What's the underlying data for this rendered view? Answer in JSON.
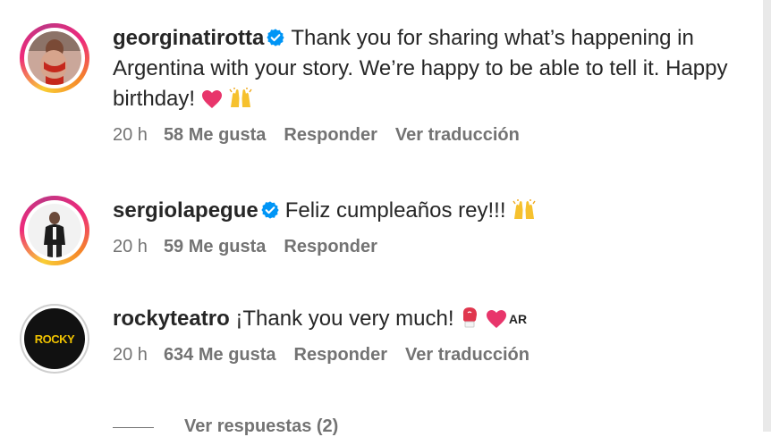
{
  "comments": [
    {
      "username": "georginatirotta",
      "verified": true,
      "text": "Thank you for sharing what’s happening in Argentina with your story. We’re happy to be able to tell it. Happy birthday!",
      "emojis": [
        "heart-icon",
        "raising-hands-icon"
      ],
      "time": "20 h",
      "likes": "58 Me gusta",
      "reply": "Responder",
      "translate": "Ver traducción"
    },
    {
      "username": "sergiolapegue",
      "verified": true,
      "text": "Feliz cumpleaños rey!!!",
      "emojis": [
        "raising-hands-icon"
      ],
      "time": "20 h",
      "likes": "59 Me gusta",
      "reply": "Responder"
    },
    {
      "username": "rockyteatro",
      "verified": false,
      "text": "¡Thank you very much!",
      "emojis": [
        "boxing-glove-icon",
        "heart-icon"
      ],
      "flag_text": "AR",
      "avatar_text": "ROCKY",
      "time": "20 h",
      "likes": "634 Me gusta",
      "reply": "Responder",
      "translate": "Ver traducción"
    }
  ],
  "view_replies": "Ver respuestas (2)",
  "colors": {
    "text": "#262626",
    "secondary": "#737373",
    "verified": "#0095f6",
    "heart": "#e8356b"
  }
}
